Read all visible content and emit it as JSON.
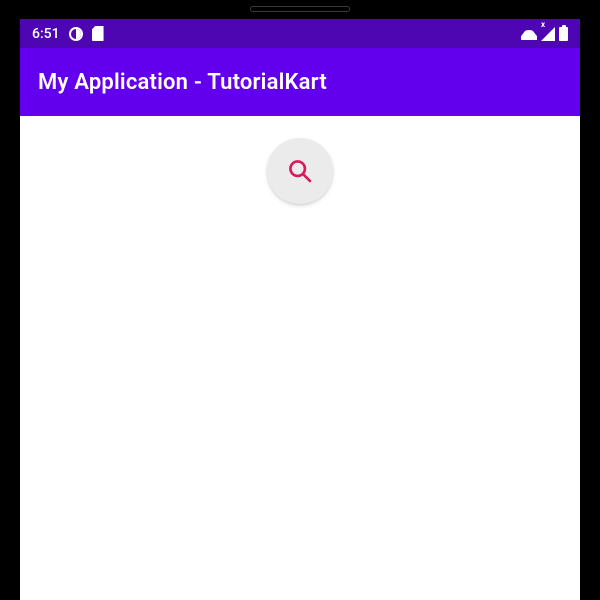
{
  "status_bar": {
    "time": "6:51",
    "icons_left": [
      "contrast-icon",
      "sd-icon"
    ],
    "icons_right": [
      "wifi-icon",
      "signal-icon",
      "battery-icon"
    ]
  },
  "app_bar": {
    "title": "My Application - TutorialKart"
  },
  "content": {
    "fab_icon": "search-icon"
  },
  "colors": {
    "primary": "#6200EE",
    "primary_dark": "#4d06b2",
    "accent": "#d81b60",
    "fab_bg": "#ebebeb"
  }
}
